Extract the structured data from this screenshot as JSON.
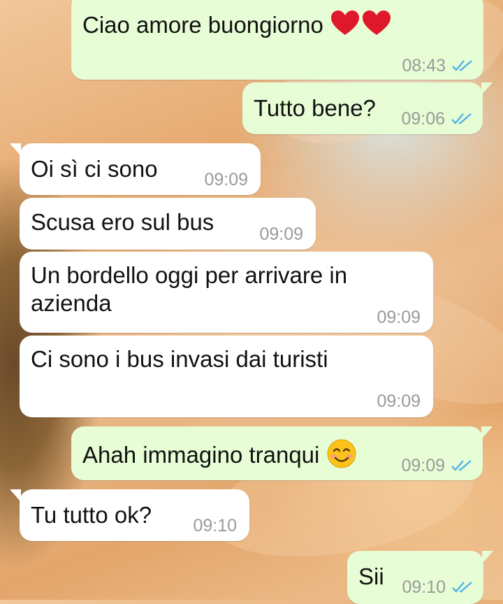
{
  "messages": [
    {
      "direction": "out",
      "text": "Ciao amore buongiorno",
      "time": "08:43",
      "status": "read",
      "emoji": [
        "heart",
        "heart"
      ]
    },
    {
      "direction": "out",
      "text": "Tutto bene?",
      "time": "09:06",
      "status": "read"
    },
    {
      "direction": "in",
      "text": "Oi sì ci sono",
      "time": "09:09"
    },
    {
      "direction": "in",
      "text": "Scusa ero sul bus",
      "time": "09:09"
    },
    {
      "direction": "in",
      "text": "Un bordello oggi per arrivare in azienda",
      "time": "09:09"
    },
    {
      "direction": "in",
      "text": "Ci sono i bus invasi dai turisti",
      "time": "09:09"
    },
    {
      "direction": "out",
      "text": "Ahah immagino tranqui",
      "time": "09:09",
      "status": "read",
      "emoji": [
        "smiling-face"
      ]
    },
    {
      "direction": "in",
      "text": "Tu tutto ok?",
      "time": "09:10"
    },
    {
      "direction": "out",
      "text": "Sii",
      "time": "09:10",
      "status": "read"
    }
  ],
  "colors": {
    "outgoing_bubble": "#e7fdd5",
    "incoming_bubble": "#ffffff",
    "read_ticks": "#4fb3e8",
    "timestamp": "#9a9a9a"
  }
}
